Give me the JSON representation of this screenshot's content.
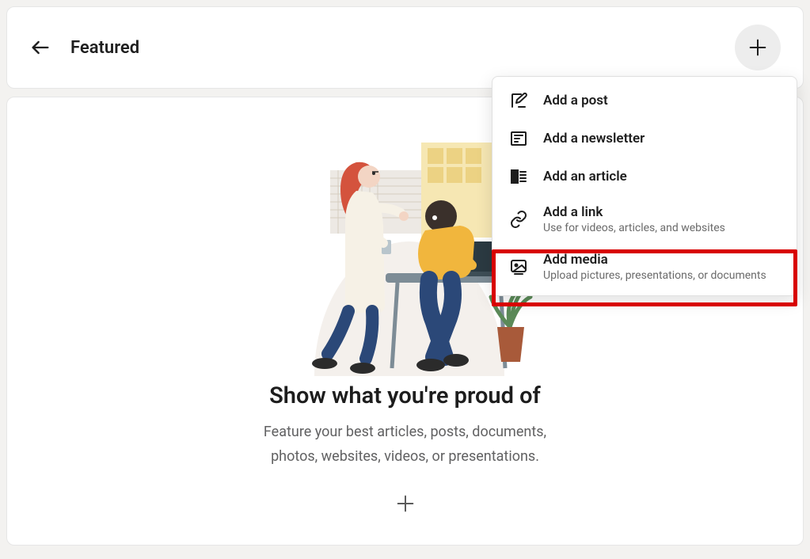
{
  "header": {
    "title": "Featured"
  },
  "dropdown": {
    "items": [
      {
        "title": "Add a post",
        "sub": ""
      },
      {
        "title": "Add a newsletter",
        "sub": ""
      },
      {
        "title": "Add an article",
        "sub": ""
      },
      {
        "title": "Add a link",
        "sub": "Use for videos, articles, and websites"
      },
      {
        "title": "Add media",
        "sub": "Upload pictures, presentations, or documents"
      }
    ]
  },
  "main": {
    "heading": "Show what you're proud of",
    "subtext": "Feature your best articles, posts, documents, photos, websites, videos, or presentations."
  }
}
